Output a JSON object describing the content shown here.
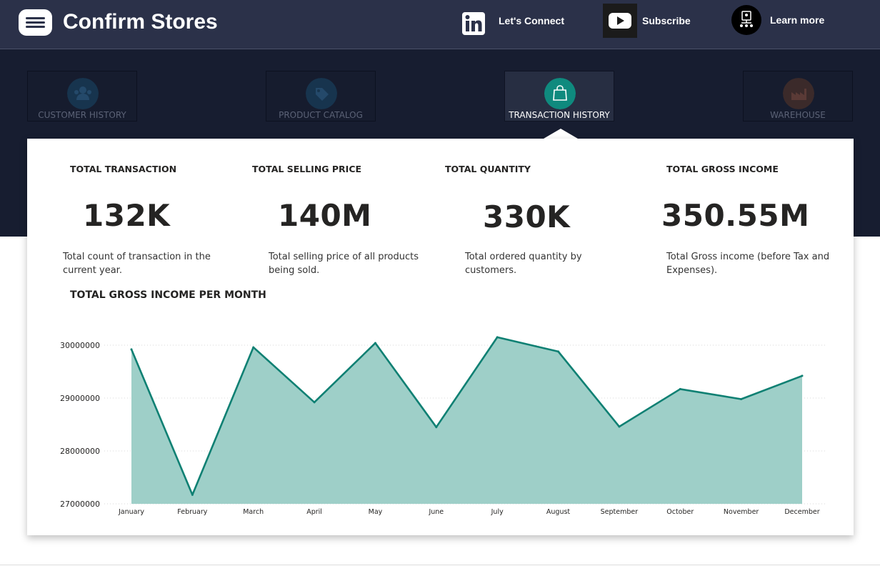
{
  "header": {
    "title": "Confirm Stores",
    "links": [
      {
        "label": "Let's Connect",
        "icon": "linkedin-icon"
      },
      {
        "label": "Subscribe",
        "icon": "youtube-icon"
      },
      {
        "label": "Learn more",
        "icon": "learn-more-icon"
      }
    ]
  },
  "nav": {
    "tabs": [
      {
        "label": "CUSTOMER HISTORY",
        "icon": "customers-icon",
        "color": "#17344e"
      },
      {
        "label": "PRODUCT CATALOG",
        "icon": "tag-icon",
        "color": "#17344e"
      },
      {
        "label": "TRANSACTION HISTORY",
        "icon": "shopping-bag-icon",
        "color": "#0f8a7e"
      },
      {
        "label": "WAREHOUSE",
        "icon": "factory-icon",
        "color": "#3b2a2a"
      }
    ],
    "active_index": 2
  },
  "kpis": [
    {
      "title": "TOTAL TRANSACTION",
      "value": "132K",
      "desc": "Total count of transaction in the current year."
    },
    {
      "title": "TOTAL SELLING PRICE",
      "value": "140M",
      "desc": "Total selling price of all products being sold."
    },
    {
      "title": "TOTAL QUANTITY",
      "value": "330K",
      "desc": "Total ordered quantity by customers."
    },
    {
      "title": "TOTAL GROSS INCOME",
      "value": "350.55M",
      "desc": "Total Gross income (before Tax and Expenses)."
    }
  ],
  "chart": {
    "title": "TOTAL GROSS INCOME PER MONTH"
  },
  "chart_data": {
    "type": "area",
    "categories": [
      "January",
      "February",
      "March",
      "April",
      "May",
      "June",
      "July",
      "August",
      "September",
      "October",
      "November",
      "December"
    ],
    "values": [
      29920000,
      27170000,
      29960000,
      28920000,
      30040000,
      28450000,
      30150000,
      29880000,
      28460000,
      29170000,
      28980000,
      29420000
    ],
    "yticks": [
      "30000000",
      "29000000",
      "28000000",
      "27000000"
    ],
    "ylim": [
      27000000,
      30000000
    ],
    "grid": true,
    "line_color": "#0f8073",
    "fill_color": "#9ecfc8"
  }
}
